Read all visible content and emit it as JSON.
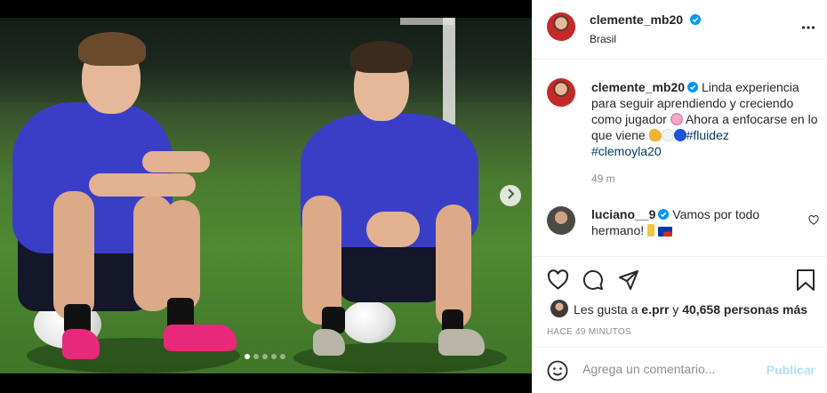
{
  "post": {
    "author": {
      "username": "clemente_mb20",
      "verified": true,
      "location": "Brasil"
    },
    "photo": {
      "slides_total": 5,
      "active_slide": 1
    },
    "caption": {
      "username": "clemente_mb20",
      "text": "Linda experiencia para seguir aprendiendo y creciendo como jugador",
      "text2": "Ahora a enfocarse en lo que viene",
      "hashtag1": "#fluidez",
      "hashtag2": "#clemoyla20",
      "time": "49 m"
    },
    "comments": [
      {
        "username": "luciano__9",
        "verified": true,
        "text": "Vamos por todo hermano!"
      }
    ],
    "likes": {
      "prefix": "Les gusta a",
      "first_user": "e.prr",
      "joiner": "y",
      "others": "40,658 personas más"
    },
    "posted_ago": "HACE 49 MINUTOS",
    "add_comment": {
      "placeholder": "Agrega un comentario...",
      "publish_label": "Publicar"
    }
  },
  "colors": {
    "verified": "#0095f6",
    "link": "#00376b",
    "muted": "#8e8e8e",
    "publish_disabled": "#b2dffc",
    "jersey": "#3a3ec7"
  },
  "icons": {
    "more": "more-horizontal-icon",
    "next": "chevron-right-icon",
    "like": "heart-icon",
    "comment": "comment-bubble-icon",
    "share": "paper-plane-icon",
    "save": "bookmark-icon",
    "emoji": "smiley-icon"
  }
}
